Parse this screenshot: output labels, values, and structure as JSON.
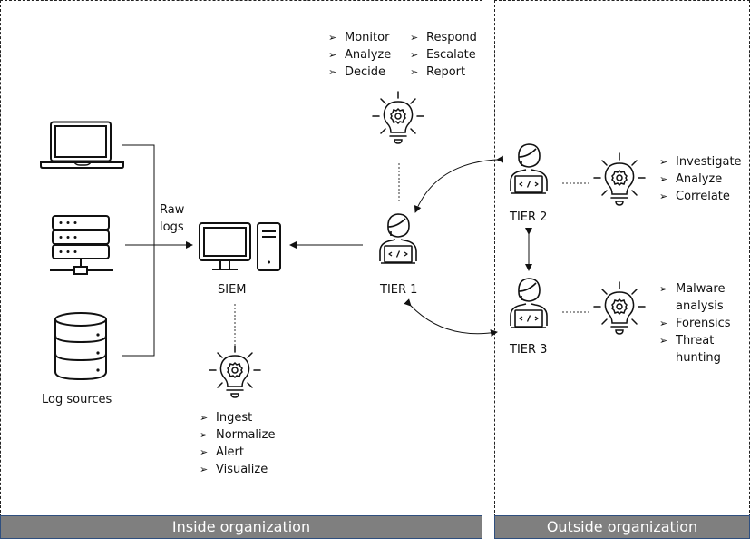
{
  "regions": {
    "inside": {
      "label": "Inside organization"
    },
    "outside": {
      "label": "Outside organization"
    }
  },
  "log_sources": {
    "label": "Log sources",
    "devices": [
      "laptop",
      "server-rack",
      "database"
    ]
  },
  "raw_logs_label": "Raw logs",
  "siem": {
    "label": "SIEM",
    "functions": [
      "Ingest",
      "Normalize",
      "Alert",
      "Visualize"
    ]
  },
  "tier1": {
    "label": "TIER 1",
    "functions_col1": [
      "Monitor",
      "Analyze",
      "Decide"
    ],
    "functions_col2": [
      "Respond",
      "Escalate",
      "Report"
    ]
  },
  "tier2": {
    "label": "TIER 2",
    "functions": [
      "Investigate",
      "Analyze",
      "Correlate"
    ]
  },
  "tier3": {
    "label": "TIER 3",
    "functions": [
      "Malware analysis",
      "Forensics",
      "Threat hunting"
    ]
  },
  "colors": {
    "footer_bg": "#7f7f7f",
    "footer_border": "#2f4f7f",
    "line": "#111111"
  }
}
